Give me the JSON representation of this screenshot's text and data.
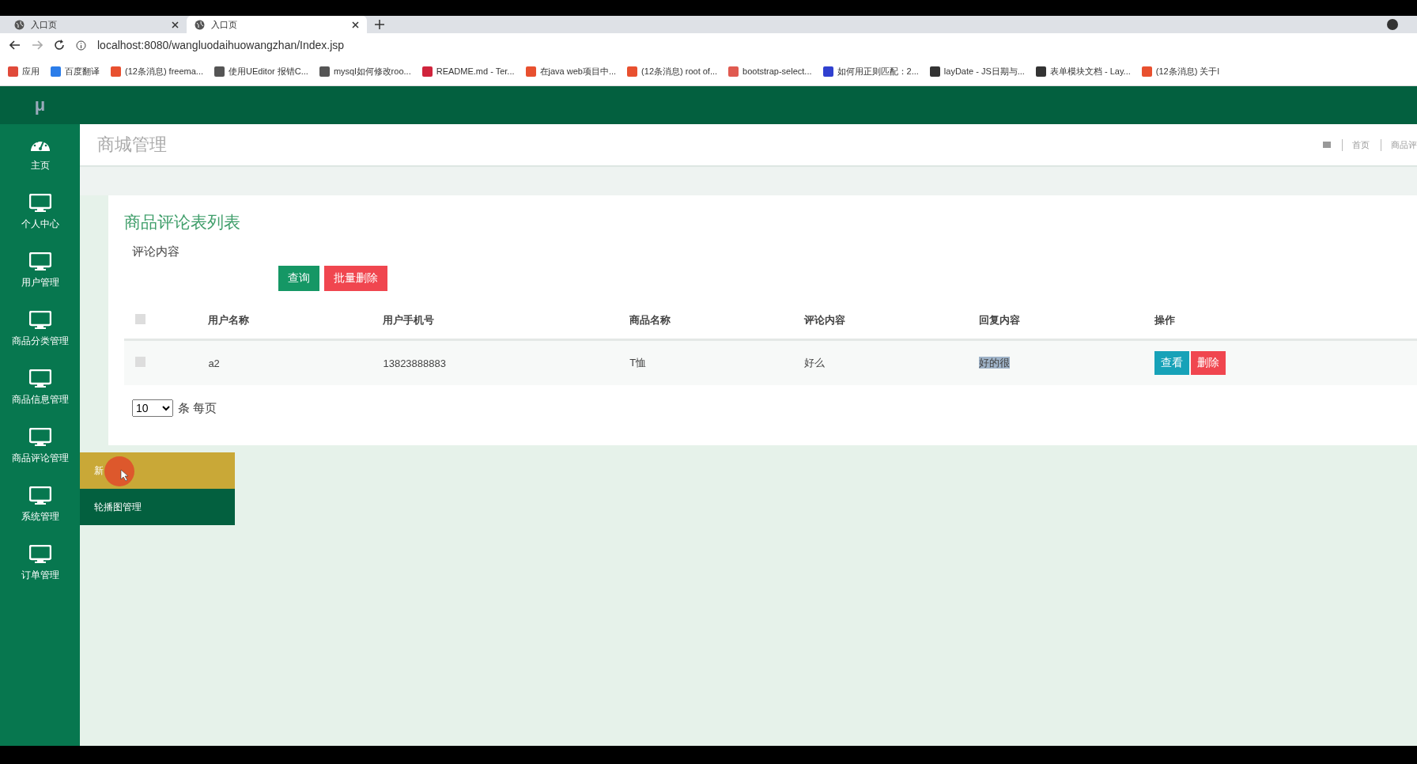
{
  "browser": {
    "tabs": [
      {
        "title": "入口页",
        "selected": false
      },
      {
        "title": "入口页",
        "selected": true
      }
    ],
    "url": "localhost:8080/wangluodaihuowangzhan/Index.jsp",
    "bookmarks": [
      {
        "label": "应用",
        "color": "#e04a3a"
      },
      {
        "label": "百度翻译",
        "color": "#2b7de9"
      },
      {
        "label": "(12条消息) freema...",
        "color": "#e8502f"
      },
      {
        "label": "使用UEditor 报错C...",
        "color": "#555555"
      },
      {
        "label": "mysql如何修改roo...",
        "color": "#555555"
      },
      {
        "label": "README.md - Ter...",
        "color": "#d0243c"
      },
      {
        "label": "在java web项目中...",
        "color": "#e8502f"
      },
      {
        "label": "(12条消息) root of...",
        "color": "#e8502f"
      },
      {
        "label": "bootstrap-select...",
        "color": "#e05a50"
      },
      {
        "label": "如何用正则匹配：2...",
        "color": "#3040d0"
      },
      {
        "label": "layDate - JS日期与...",
        "color": "#333333"
      },
      {
        "label": "表单模块文档 - Lay...",
        "color": "#333333"
      },
      {
        "label": "(12条消息) 关于l",
        "color": "#e8502f"
      }
    ]
  },
  "sidebar": {
    "logo": "μ",
    "items": [
      {
        "label": "主页",
        "kind": "dashboard"
      },
      {
        "label": "个人中心",
        "kind": "monitor"
      },
      {
        "label": "用户管理",
        "kind": "monitor"
      },
      {
        "label": "商品分类管理",
        "kind": "monitor"
      },
      {
        "label": "商品信息管理",
        "kind": "monitor"
      },
      {
        "label": "商品评论管理",
        "kind": "monitor"
      },
      {
        "label": "系统管理",
        "kind": "monitor"
      },
      {
        "label": "订单管理",
        "kind": "monitor"
      }
    ]
  },
  "submenu": [
    {
      "label": "新",
      "selected": true
    },
    {
      "label": "轮播图管理",
      "selected": false
    }
  ],
  "header": {
    "title": "商城管理",
    "breadcrumb": [
      "首页",
      "商品评"
    ]
  },
  "card": {
    "title": "商品评论表列表",
    "search_label": "评论内容",
    "buttons": [
      {
        "label": "查询",
        "kind": "primary"
      },
      {
        "label": "批量删除",
        "kind": "danger"
      }
    ],
    "table": {
      "all_checked": false,
      "columns": [
        "用户名称",
        "用户手机号",
        "商品名称",
        "评论内容",
        "回复内容",
        "操作"
      ],
      "rows": [
        {
          "checked": false,
          "cells": [
            "a2",
            "13823888883",
            "T恤",
            "好么",
            "好的很"
          ],
          "actions": [
            {
              "label": "查看",
              "kind": "info"
            },
            {
              "label": "删除",
              "kind": "danger"
            }
          ]
        }
      ]
    },
    "page_size": "10",
    "page_size_label": "条 每页"
  }
}
